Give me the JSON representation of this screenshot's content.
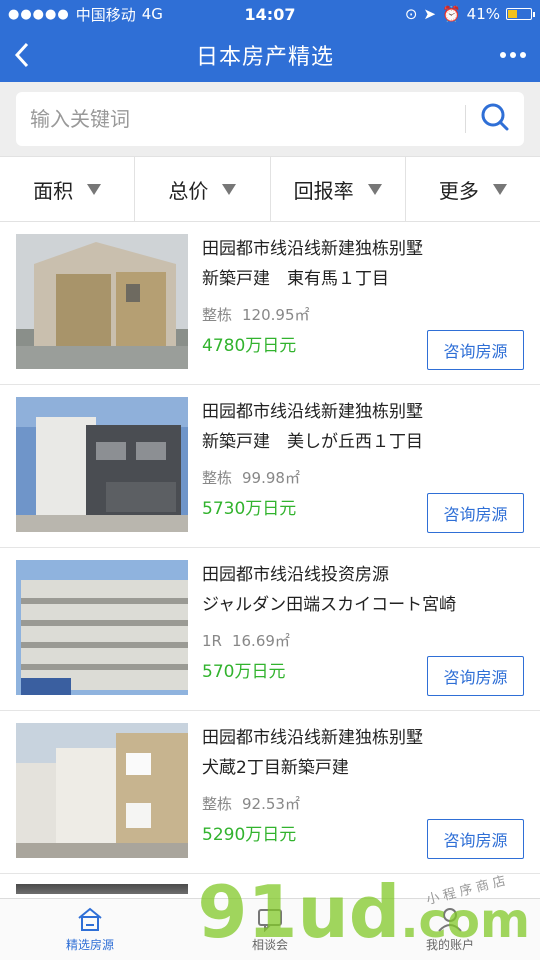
{
  "status_bar": {
    "carrier": "中国移动",
    "network": "4G",
    "time": "14:07",
    "battery": "41%",
    "battery_level": 0.41
  },
  "nav": {
    "title": "日本房产精选"
  },
  "search": {
    "placeholder": "输入关键词"
  },
  "filters": [
    {
      "label": "面积"
    },
    {
      "label": "总价"
    },
    {
      "label": "回报率"
    },
    {
      "label": "更多"
    }
  ],
  "listings": [
    {
      "line1": "田园都市线沿线新建独栋别墅",
      "line2": "新築戸建　東有馬１丁目",
      "type": "整栋",
      "area": "120.95㎡",
      "price": "4780万日元",
      "button": "咨询房源"
    },
    {
      "line1": "田园都市线沿线新建独栋别墅",
      "line2": "新築戸建　美しが丘西１丁目",
      "type": "整栋",
      "area": "99.98㎡",
      "price": "5730万日元",
      "button": "咨询房源"
    },
    {
      "line1": "田园都市线沿线投资房源",
      "line2": "ジャルダン田端スカイコート宮崎",
      "type": "1R",
      "area": "16.69㎡",
      "price": "570万日元",
      "button": "咨询房源"
    },
    {
      "line1": "田园都市线沿线新建独栋别墅",
      "line2": "犬蔵2丁目新築戸建",
      "type": "整栋",
      "area": "92.53㎡",
      "price": "5290万日元",
      "button": "咨询房源"
    }
  ],
  "tabbar": [
    {
      "label": "精选房源",
      "icon": "home-icon"
    },
    {
      "label": "相谈会",
      "icon": "chat-icon"
    },
    {
      "label": "我的账户",
      "icon": "user-icon"
    }
  ],
  "watermark": {
    "text": "91ud",
    "suffix": ".com",
    "sub": "小程序商店"
  },
  "colors": {
    "primary": "#2f6fd6",
    "price": "#32b32e"
  }
}
